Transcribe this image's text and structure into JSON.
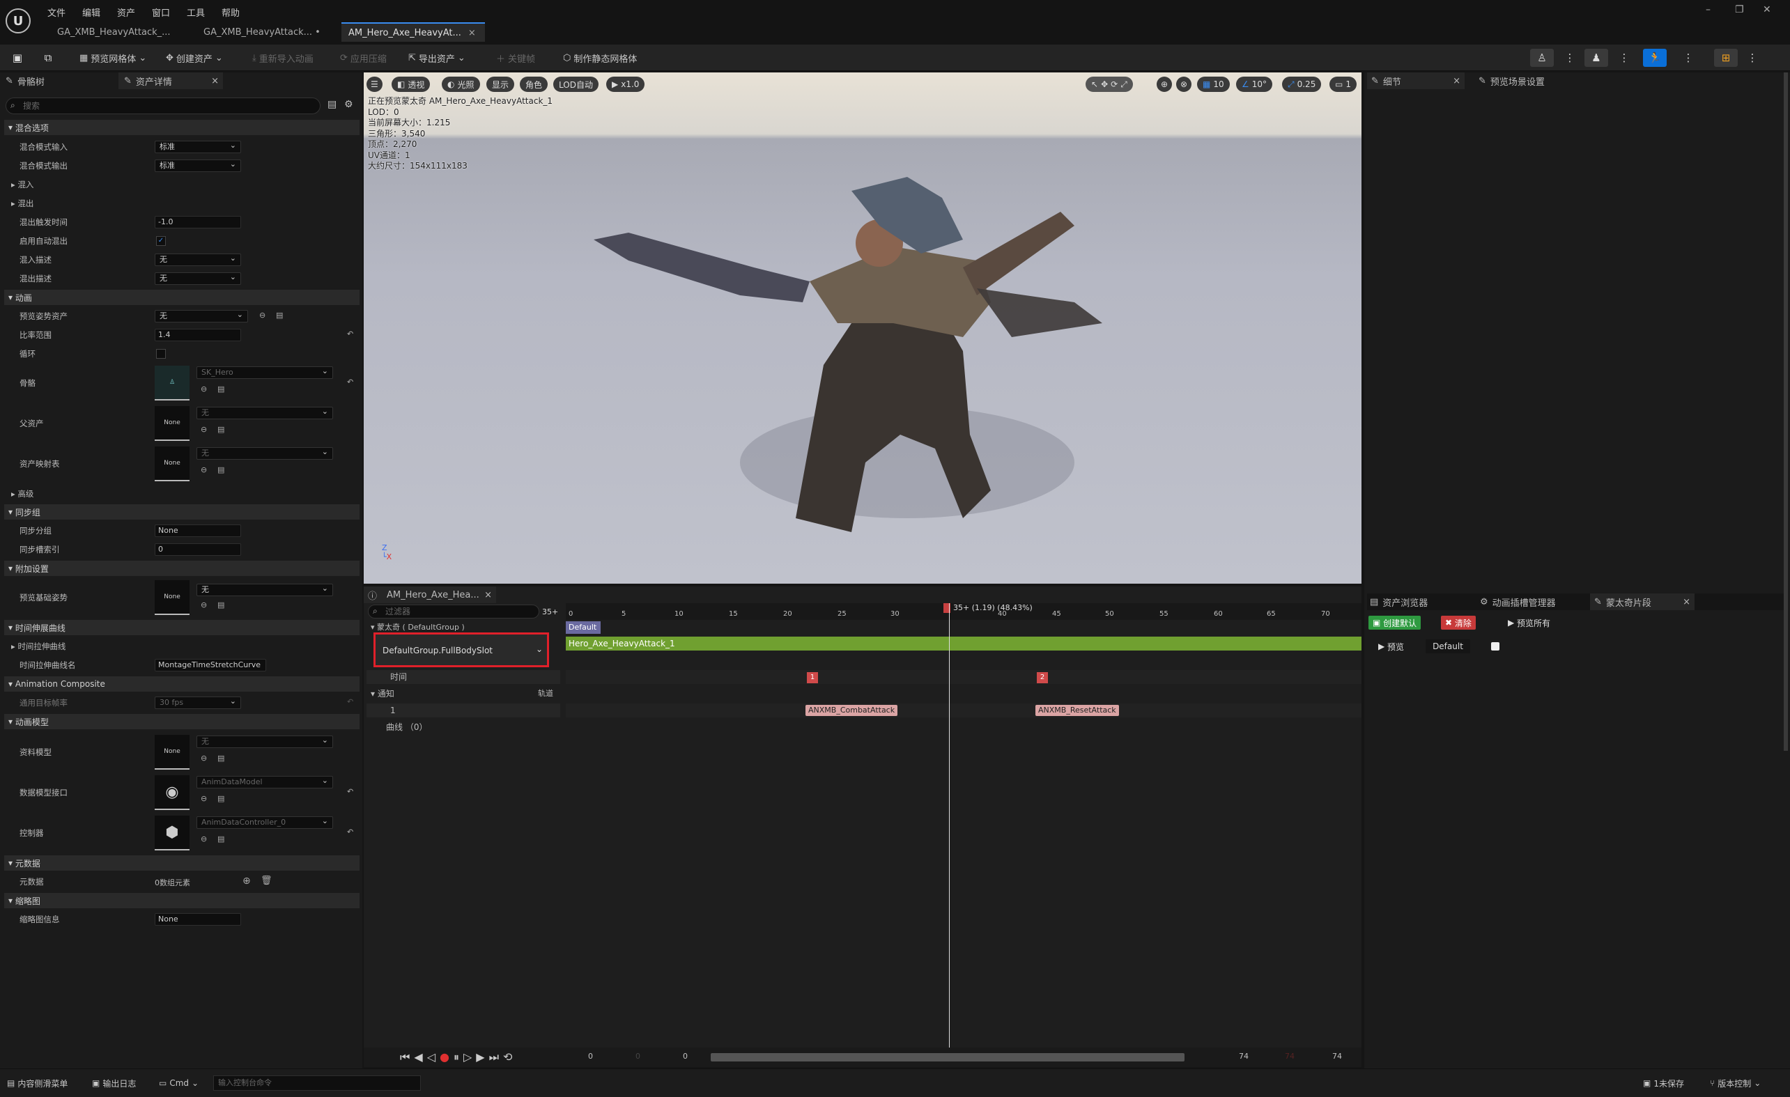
{
  "menu": [
    "文件",
    "编辑",
    "资产",
    "窗口",
    "工具",
    "帮助"
  ],
  "tabs": [
    {
      "label": "GA_XMB_HeavyAttack_..."
    },
    {
      "label": "GA_XMB_HeavyAttack... •"
    },
    {
      "label": "AM_Hero_Axe_HeavyAt..."
    }
  ],
  "toolbar": {
    "preview_mesh": "预览网格体",
    "create_asset": "创建资产",
    "reimport": "重新导入动画",
    "apply_compression": "应用压缩",
    "export_asset": "导出资产",
    "keyframe": "关键帧",
    "make_static_mesh": "制作静态网格体"
  },
  "left_tabs": {
    "skeleton_tree": "骨骼树",
    "asset_details": "资产详情"
  },
  "search": {
    "placeholder": "搜索"
  },
  "details": {
    "blend_options": "混合选项",
    "blend_in_mode": "混合模式输入",
    "blend_in_mode_val": "标准",
    "blend_out_mode": "混合模式输出",
    "blend_out_mode_val": "标准",
    "blend_in": "混入",
    "blend_out": "混出",
    "blend_out_trigger": "混出触发时间",
    "blend_out_trigger_val": "-1.0",
    "auto_blend_out": "启用自动混出",
    "blend_in_desc": "混入描述",
    "blend_in_desc_val": "无",
    "blend_out_desc": "混出描述",
    "blend_out_desc_val": "无",
    "animation": "动画",
    "preview_pose": "预览姿势资产",
    "preview_pose_val": "无",
    "rate_scale": "比率范围",
    "rate_scale_val": "1.4",
    "loop": "循环",
    "skeleton": "骨骼",
    "skeleton_val": "SK_Hero",
    "parent_asset": "父资产",
    "parent_asset_val": "无",
    "asset_mapping": "资产映射表",
    "asset_mapping_val": "无",
    "none": "None",
    "advanced": "高级",
    "sync_group": "同步组",
    "sync_group_name": "同步分组",
    "sync_group_name_val": "None",
    "sync_marker_index": "同步槽索引",
    "sync_marker_index_val": "0",
    "additive": "附加设置",
    "preview_base_pose": "预览基础姿势",
    "preview_base_pose_val": "无",
    "time_stretch": "时间伸展曲线",
    "time_stretch_curve": "时间拉伸曲线",
    "time_stretch_curve_name": "时间拉伸曲线名",
    "time_stretch_curve_name_val": "MontageTimeStretchCurve",
    "anim_composite": "Animation Composite",
    "target_frame_rate": "通用目标帧率",
    "target_frame_rate_val": "30 fps",
    "anim_model": "动画模型",
    "data_model": "资料模型",
    "data_model_val": "无",
    "data_model_interface": "数据模型接口",
    "data_model_interface_val": "AnimDataModel",
    "controller": "控制器",
    "controller_val": "AnimDataController_0",
    "metadata": "元数据",
    "metadata_row": "元数据",
    "metadata_val": "0数组元素",
    "thumbnail": "缩略图",
    "thumbnail_info": "缩略图信息",
    "thumbnail_info_val": "None"
  },
  "viewport": {
    "perspective": "透视",
    "lit": "光照",
    "show": "显示",
    "character": "角色",
    "lod_auto": "LOD自动",
    "speed": "x1.0",
    "grid": "10",
    "angle": "10°",
    "scale": "0.25",
    "cam": "1",
    "stats": [
      "正在预览蒙太奇 AM_Hero_Axe_HeavyAttack_1",
      "LOD：0",
      "当前屏幕大小：1.215",
      "三角形：3,540",
      "顶点：2,270",
      "UV通道：1",
      "大约尺寸：154x111x183"
    ]
  },
  "right_tabs": {
    "details": "细节",
    "preview_settings": "预览场景设置"
  },
  "timeline": {
    "tab": "AM_Hero_Axe_Hea...",
    "filter_placeholder": "过滤器",
    "frame_box": "35+",
    "playhead": "35+ (1.19) (48.43%)",
    "montage_group": "蒙太奇 ( DefaultGroup )",
    "slot": "DefaultGroup.FullBodySlot",
    "default_label": "Default",
    "segment": "Hero_Axe_HeavyAttack_1",
    "time": "时间",
    "notifies": "通知",
    "track": "轨道",
    "track1": "1",
    "curves": "曲线 （0）",
    "ticks": [
      "0",
      "5",
      "10",
      "15",
      "20",
      "25",
      "30",
      "35",
      "40",
      "45",
      "50",
      "55",
      "60",
      "65",
      "70"
    ],
    "markers": [
      "1",
      "2"
    ],
    "notify1": "ANXMB_CombatAttack",
    "notify2": "ANXMB_ResetAttack",
    "counters": [
      "0",
      "0",
      "0",
      "74",
      "74",
      "74"
    ]
  },
  "montage_panel": {
    "asset_browser": "资产浏览器",
    "slot_manager": "动画插槽管理器",
    "montage_sections": "蒙太奇片段",
    "create_default": "创建默认",
    "clear": "清除",
    "preview_all": "预览所有",
    "preview": "预览",
    "default": "Default"
  },
  "statusbar": {
    "content_drawer": "内容侧滑菜单",
    "output_log": "输出日志",
    "cmd": "Cmd",
    "cmd_placeholder": "输入控制台命令",
    "unsaved": "1未保存",
    "source_control": "版本控制"
  }
}
